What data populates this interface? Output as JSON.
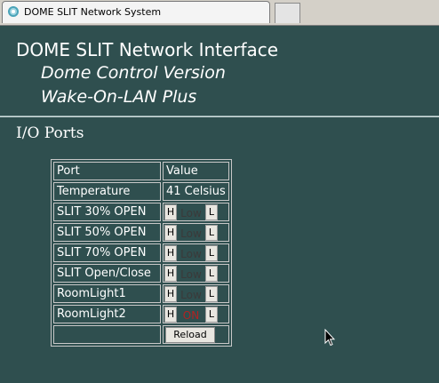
{
  "window": {
    "tab_title": "DOME SLIT Network System"
  },
  "header": {
    "title": "DOME SLIT Network Interface",
    "subtitle1": "Dome Control Version",
    "subtitle2": "Wake-On-LAN Plus"
  },
  "section": {
    "title": "I/O Ports"
  },
  "table": {
    "col_port": "Port",
    "col_value": "Value",
    "temperature_label": "Temperature",
    "temperature_value": "41 Celsius",
    "rows": [
      {
        "label": "SLIT 30% OPEN",
        "state": "Low",
        "state_color": "#3a3a3a"
      },
      {
        "label": "SLIT 50% OPEN",
        "state": "Low",
        "state_color": "#3a3a3a"
      },
      {
        "label": "SLIT 70% OPEN",
        "state": "Low",
        "state_color": "#3a3a3a"
      },
      {
        "label": "SLIT Open/Close",
        "state": "Low",
        "state_color": "#3a3a3a"
      },
      {
        "label": "RoomLight1",
        "state": "Low",
        "state_color": "#3a3a3a"
      },
      {
        "label": "RoomLight2",
        "state": "ON",
        "state_color": "#b22222"
      }
    ],
    "high_button": "H",
    "low_button": "L",
    "reload_button": "Reload"
  },
  "colors": {
    "page_background": "#2f4f4f",
    "text": "#ffffff"
  }
}
